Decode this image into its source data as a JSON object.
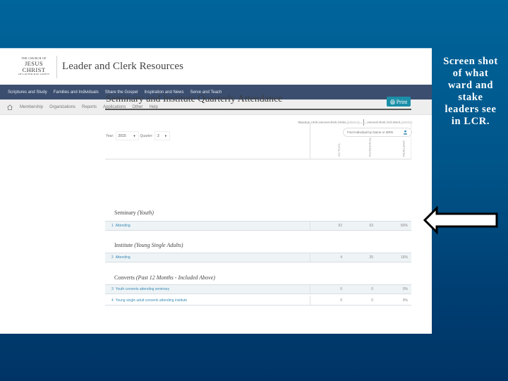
{
  "header": {
    "logo": {
      "line1": "THE CHURCH OF",
      "line2": "JESUS CHRIST",
      "line3": "OF LATTER-DAY SAINTS"
    },
    "app_title": "Leader and Clerk Resources"
  },
  "main_nav": [
    {
      "label": "Scriptures and Study"
    },
    {
      "label": "Families and Individuals"
    },
    {
      "label": "Share the Gospel"
    },
    {
      "label": "Inspiration and News"
    },
    {
      "label": "Serve and Teach"
    }
  ],
  "sub_nav": {
    "home_icon": "home-icon",
    "items": [
      {
        "label": "Membership"
      },
      {
        "label": "Organizations"
      },
      {
        "label": "Reports"
      },
      {
        "label": "Applications"
      },
      {
        "label": "Other"
      },
      {
        "label": "Help"
      }
    ]
  },
  "unit": {
    "stake": "Riverton Utah Harvest Park Stake",
    "stake_number": "(445312)",
    "ward": "Harvest Park 2nd Ward",
    "ward_number": "(48332)"
  },
  "search": {
    "placeholder": "Find Individual by Name or MRN",
    "icon": "person-icon"
  },
  "page": {
    "title": "Seminary and Institute Quarterly Attendance",
    "print_label": "Print",
    "print_icon": "printer-icon"
  },
  "filters": {
    "year_label": "Year:",
    "year_value": "2015",
    "quarter_label": "Quarter:",
    "quarter_value": "3"
  },
  "columns": [
    "ACTUAL",
    "POTENTIAL",
    "PERCENT"
  ],
  "sections": [
    {
      "title": "Seminary",
      "subtitle": "(Youth)",
      "rows": [
        {
          "num": "1",
          "label": "Attending",
          "actual": "52",
          "potential": "63",
          "percent": "83%"
        }
      ]
    },
    {
      "title": "Institute",
      "subtitle": "(Young Single Adults)",
      "rows": [
        {
          "num": "2",
          "label": "Attending",
          "actual": "4",
          "potential": "25",
          "percent": "16%"
        }
      ]
    },
    {
      "title": "Converts",
      "subtitle": "(Past 12 Months - Included Above)",
      "rows": [
        {
          "num": "3",
          "label": "Youth converts attending seminary",
          "actual": "0",
          "potential": "0",
          "percent": "0%"
        },
        {
          "num": "4",
          "label": "Young single adult converts attending institute",
          "actual": "0",
          "potential": "0",
          "percent": "0%"
        }
      ]
    }
  ],
  "slide": {
    "caption": "Screen shot of what ward and stake leaders see in LCR.",
    "arrow_icon": "left-arrow-icon",
    "colors": {
      "background_top": "#00659b",
      "background_bottom": "#003466",
      "nav_bar": "#3b4e6f",
      "print_button": "#1b8fa8",
      "link": "#3a8bb5"
    }
  }
}
